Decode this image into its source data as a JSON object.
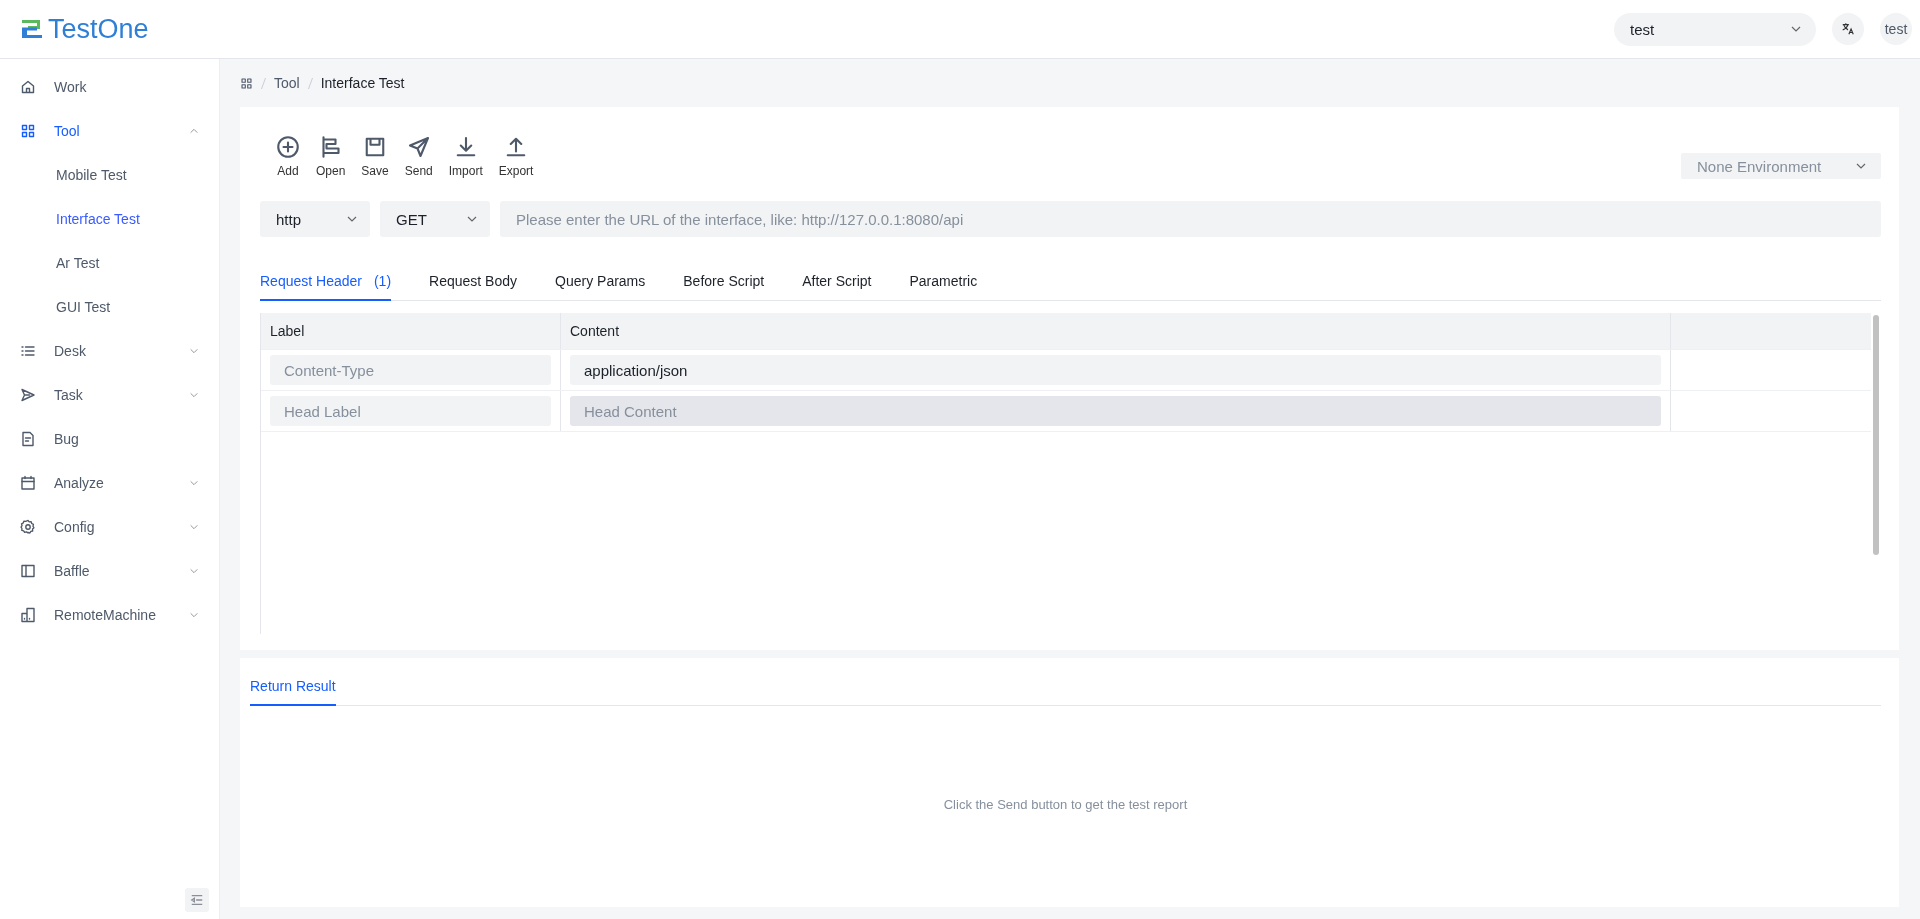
{
  "header": {
    "logo": "TestOne",
    "project_select": {
      "value": "test"
    },
    "avatar": "test"
  },
  "sidebar": {
    "items": [
      {
        "label": "Work",
        "kind": "link",
        "selected": false
      },
      {
        "label": "Tool",
        "kind": "group",
        "expanded": true,
        "selected": true,
        "children": [
          {
            "label": "Mobile Test",
            "selected": false
          },
          {
            "label": "Interface Test",
            "selected": true
          },
          {
            "label": "Ar Test",
            "selected": false
          },
          {
            "label": "GUI Test",
            "selected": false
          }
        ]
      },
      {
        "label": "Desk",
        "kind": "group",
        "expanded": false,
        "selected": false
      },
      {
        "label": "Task",
        "kind": "group",
        "expanded": false,
        "selected": false
      },
      {
        "label": "Bug",
        "kind": "link",
        "selected": false
      },
      {
        "label": "Analyze",
        "kind": "group",
        "expanded": false,
        "selected": false
      },
      {
        "label": "Config",
        "kind": "group",
        "expanded": false,
        "selected": false
      },
      {
        "label": "Baffle",
        "kind": "group",
        "expanded": false,
        "selected": false
      },
      {
        "label": "RemoteMachine",
        "kind": "group",
        "expanded": false,
        "selected": false
      }
    ]
  },
  "breadcrumb": [
    "Tool",
    "Interface Test"
  ],
  "toolbar": [
    "Add",
    "Open",
    "Save",
    "Send",
    "Import",
    "Export"
  ],
  "environment_select": {
    "placeholder": "None Environment"
  },
  "request": {
    "protocol": "http",
    "method": "GET",
    "url": {
      "placeholder": "Please enter the URL of the interface, like: http://127.0.0.1:8080/api"
    }
  },
  "tabs": [
    {
      "label": "Request Header",
      "count": "(1)",
      "selected": true
    },
    {
      "label": "Request Body",
      "selected": false
    },
    {
      "label": "Query Params",
      "selected": false
    },
    {
      "label": "Before Script",
      "selected": false
    },
    {
      "label": "After Script",
      "selected": false
    },
    {
      "label": "Parametric",
      "selected": false
    }
  ],
  "table": {
    "columns": [
      "Label",
      "Content"
    ],
    "rows": [
      {
        "label": {
          "placeholder": "Content-Type"
        },
        "content": {
          "value": "application/json",
          "hovered": false
        }
      },
      {
        "label": {
          "placeholder": "Head Label"
        },
        "content": {
          "placeholder": "Head Content",
          "hovered": true
        }
      }
    ]
  },
  "result": {
    "tabs": [
      {
        "label": "Return Result",
        "selected": true
      }
    ],
    "empty_text": "Click the Send button to get the test report"
  }
}
